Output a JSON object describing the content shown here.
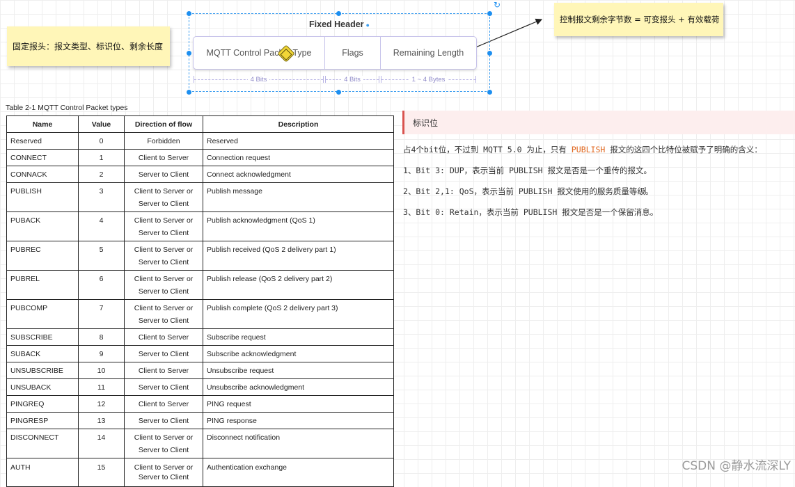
{
  "notes": {
    "left": "固定报头：报文类型、标识位、剩余长度",
    "right": "控制报文剩余字节数 = 可变报头 + 有效载荷"
  },
  "diagram": {
    "title": "Fixed Header",
    "fields": [
      {
        "label": "MQTT Control Packet Type",
        "size": "4 Bits"
      },
      {
        "label": "Flags",
        "size": "4 Bits"
      },
      {
        "label": "Remaining Length",
        "size": "1 ~ 4 Bytes"
      }
    ],
    "accent_color": "#1d8ff0"
  },
  "table": {
    "caption": "Table 2-1 MQTT Control Packet types",
    "headers": [
      "Name",
      "Value",
      "Direction of flow",
      "Description"
    ],
    "rows": [
      {
        "name": "Reserved",
        "value": "0",
        "direction": "Forbidden",
        "description": "Reserved"
      },
      {
        "name": "CONNECT",
        "value": "1",
        "direction": "Client to Server",
        "description": "Connection request"
      },
      {
        "name": "CONNACK",
        "value": "2",
        "direction": "Server to Client",
        "description": "Connect acknowledgment"
      },
      {
        "name": "PUBLISH",
        "value": "3",
        "direction": "Client to Server or\nServer to Client",
        "description": "Publish message"
      },
      {
        "name": "PUBACK",
        "value": "4",
        "direction": "Client to Server or\nServer to Client",
        "description": "Publish acknowledgment (QoS 1)"
      },
      {
        "name": "PUBREC",
        "value": "5",
        "direction": "Client to Server or\nServer to Client",
        "description": "Publish received (QoS 2 delivery part 1)"
      },
      {
        "name": "PUBREL",
        "value": "6",
        "direction": "Client to Server or\nServer to Client",
        "description": "Publish release (QoS 2 delivery part 2)"
      },
      {
        "name": "PUBCOMP",
        "value": "7",
        "direction": "Client to Server or\nServer to Client",
        "description": "Publish complete (QoS 2 delivery part 3)"
      },
      {
        "name": "SUBSCRIBE",
        "value": "8",
        "direction": "Client to Server",
        "description": "Subscribe request"
      },
      {
        "name": "SUBACK",
        "value": "9",
        "direction": "Server to Client",
        "description": "Subscribe acknowledgment"
      },
      {
        "name": "UNSUBSCRIBE",
        "value": "10",
        "direction": "Client to Server",
        "description": "Unsubscribe request"
      },
      {
        "name": "UNSUBACK",
        "value": "11",
        "direction": "Server to Client",
        "description": "Unsubscribe acknowledgment"
      },
      {
        "name": "PINGREQ",
        "value": "12",
        "direction": "Client to Server",
        "description": "PING request"
      },
      {
        "name": "PINGRESP",
        "value": "13",
        "direction": "Server to Client",
        "description": "PING response"
      },
      {
        "name": "DISCONNECT",
        "value": "14",
        "direction": "Client to Server or\nServer to Client",
        "description": "Disconnect notification"
      },
      {
        "name": "AUTH",
        "value": "15",
        "direction": "Client to Server or\nServer to Client",
        "description": "Authentication exchange"
      }
    ]
  },
  "panel": {
    "callout_title": "标识位",
    "p1_pre": "占4个bit位，不过到 MQTT 5.0 为止，只有 ",
    "p1_highlight": "PUBLISH",
    "p1_post": " 报文的这四个比特位被赋予了明确的含义：",
    "p2": "1、Bit 3: DUP，表示当前 PUBLISH 报文是否是一个重传的报文。",
    "p3": "2、Bit 2,1: QoS，表示当前 PUBLISH 报文使用的服务质量等级。",
    "p4": "3、Bit 0: Retain，表示当前 PUBLISH 报文是否是一个保留消息。",
    "highlight_color": "#e0661d"
  },
  "watermark": "CSDN @静水流深LY"
}
